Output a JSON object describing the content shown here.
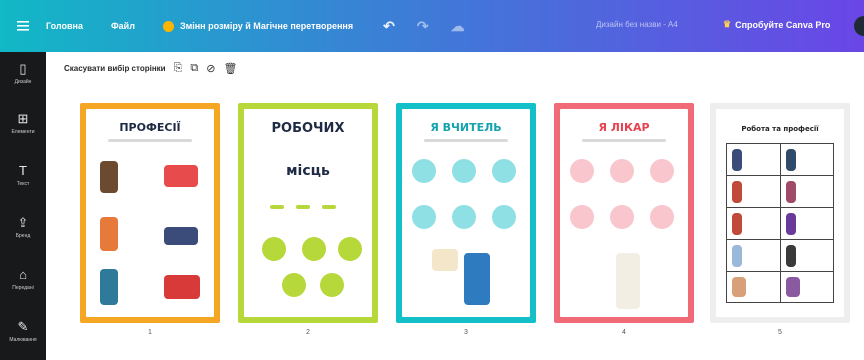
{
  "topbar": {
    "home": "Головна",
    "file": "Файл",
    "resize": "Змінн розміру й Магічне перетворення",
    "undo_icon": "undo-icon",
    "redo_icon": "redo-icon",
    "sync_icon": "cloud-sync-icon",
    "design_title": "Дизайн без назви - A4",
    "try_pro": "Спробуйте Canva Pro"
  },
  "sidebar": {
    "items": [
      {
        "icon": "▯",
        "label": "Дизайн"
      },
      {
        "icon": "⊞",
        "label": "Елементи"
      },
      {
        "icon": "T",
        "label": "Текст"
      },
      {
        "icon": "⇪",
        "label": "Бренд"
      },
      {
        "icon": "⌂",
        "label": "Передані"
      },
      {
        "icon": "✎",
        "label": "Малювання"
      }
    ]
  },
  "actionbar": {
    "deselect": "Скасувати вибір сторінки"
  },
  "pages": [
    {
      "number": "1",
      "title": "ПРОФЕСІЇ",
      "frame": "#f5a623"
    },
    {
      "number": "2",
      "title": "РОБОЧИХ",
      "frame": "#b6d83a",
      "subtitle": "місць"
    },
    {
      "number": "3",
      "title": "Я ВЧИТЕЛЬ",
      "frame": "#14c0c8"
    },
    {
      "number": "4",
      "title": "Я ЛІКАР",
      "frame": "#f06a78"
    },
    {
      "number": "5",
      "title": "Робота та професії",
      "frame": "#eeeeee"
    }
  ],
  "colors": {
    "accent_teal": "#11b8c6",
    "accent_purple": "#6a46e6",
    "sidebar": "#18191b"
  }
}
